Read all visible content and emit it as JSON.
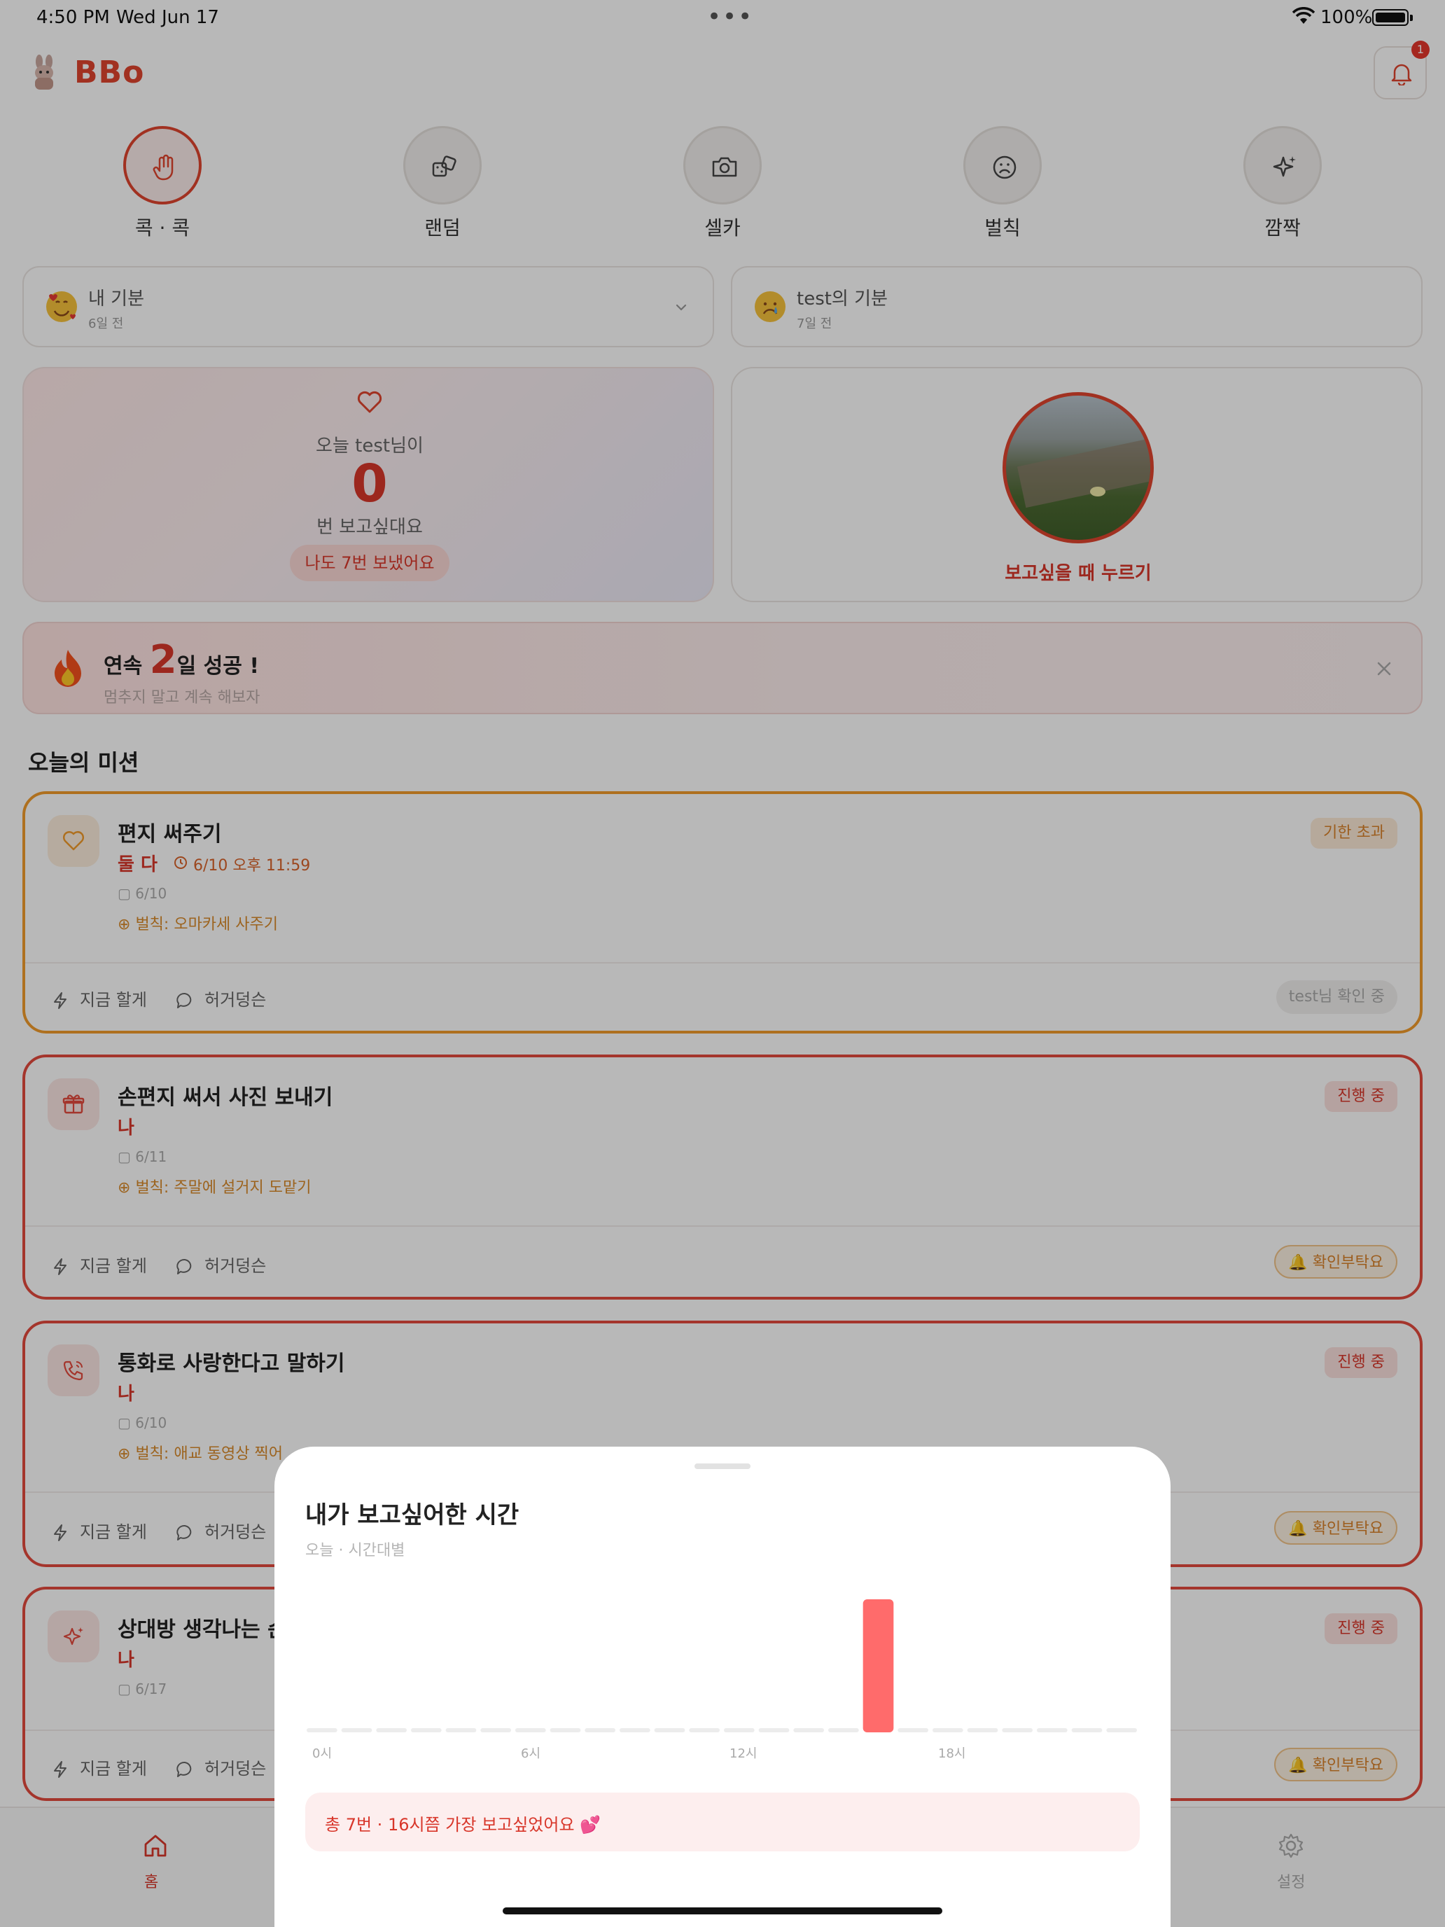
{
  "status_bar": {
    "time": "4:50 PM",
    "date": "Wed Jun 17",
    "battery": "100%"
  },
  "header": {
    "app_name": "BBo",
    "notification_count": "1"
  },
  "quick_actions": [
    {
      "label": "콕 · 콕",
      "icon": "hand-icon",
      "active": true
    },
    {
      "label": "랜덤",
      "icon": "dice-icon",
      "active": false
    },
    {
      "label": "셀카",
      "icon": "camera-icon",
      "active": false
    },
    {
      "label": "벌칙",
      "icon": "frown-icon",
      "active": false
    },
    {
      "label": "깜짝",
      "icon": "sparkle-icon",
      "active": false
    }
  ],
  "moods": {
    "mine": {
      "title": "내 기분",
      "time": "6일 전",
      "emoji": "smiling-face-with-hearts"
    },
    "partner": {
      "title": "test의 기분",
      "time": "7일 전",
      "emoji": "crying-face"
    }
  },
  "miss_card": {
    "line1": "오늘 test님이",
    "count": "0",
    "line2": "번 보고싶대요",
    "pill": "나도 7번 보냈어요"
  },
  "photo_card": {
    "label": "보고싶을 때 누르기"
  },
  "streak": {
    "prefix": "연속 ",
    "days": "2",
    "suffix": "일 성공 !",
    "subtitle": "멈추지 말고 계속 해보자"
  },
  "missions_section": {
    "title": "오늘의 미션"
  },
  "missions": [
    {
      "title": "편지 써주기",
      "who": "둘 다",
      "deadline": "6/10 오후 11:59",
      "date": "6/10",
      "penalty": "벌칙: 오마카세 사주기",
      "badge": "기한 초과",
      "action1": "지금 할게",
      "action2": "허거덩슨",
      "status": "test님 확인 중"
    },
    {
      "title": "손편지 써서 사진 보내기",
      "who": "나",
      "date": "6/11",
      "penalty": "벌칙: 주말에 설거지 도맡기",
      "badge": "진행 중",
      "action1": "지금 할게",
      "action2": "허거덩슨",
      "status": "확인부탁요"
    },
    {
      "title": "통화로 사랑한다고 말하기",
      "who": "나",
      "date": "6/10",
      "penalty": "벌칙: 애교 동영상 찍어",
      "badge": "진행 중",
      "action1": "지금 할게",
      "action2": "허거덩슨",
      "status": "확인부탁요"
    },
    {
      "title": "상대방 생각나는 순",
      "who": "나",
      "date": "6/17",
      "badge": "진행 중",
      "action1": "지금 할게",
      "action2": "허거덩슨",
      "status": "확인부탁요"
    }
  ],
  "tabbar": {
    "home_label": "홈",
    "settings_label": "설정"
  },
  "sheet": {
    "title": "내가 보고싶어한 시간",
    "subtitle": "오늘 · 시간대별",
    "summary": "총 7번 · 16시쯤 가장 보고싶었어요 💕"
  },
  "chart_data": {
    "type": "bar",
    "categories": [
      "0시",
      "1시",
      "2시",
      "3시",
      "4시",
      "5시",
      "6시",
      "7시",
      "8시",
      "9시",
      "10시",
      "11시",
      "12시",
      "13시",
      "14시",
      "15시",
      "16시",
      "17시",
      "18시",
      "19시",
      "20시",
      "21시",
      "22시",
      "23시"
    ],
    "values": [
      0,
      0,
      0,
      0,
      0,
      0,
      0,
      0,
      0,
      0,
      0,
      0,
      0,
      0,
      0,
      0,
      7,
      0,
      0,
      0,
      0,
      0,
      0,
      0
    ],
    "tick_labels": [
      "0시",
      "6시",
      "12시",
      "18시"
    ],
    "bar_color": "#ff6b6b",
    "empty_color": "#ececec"
  }
}
